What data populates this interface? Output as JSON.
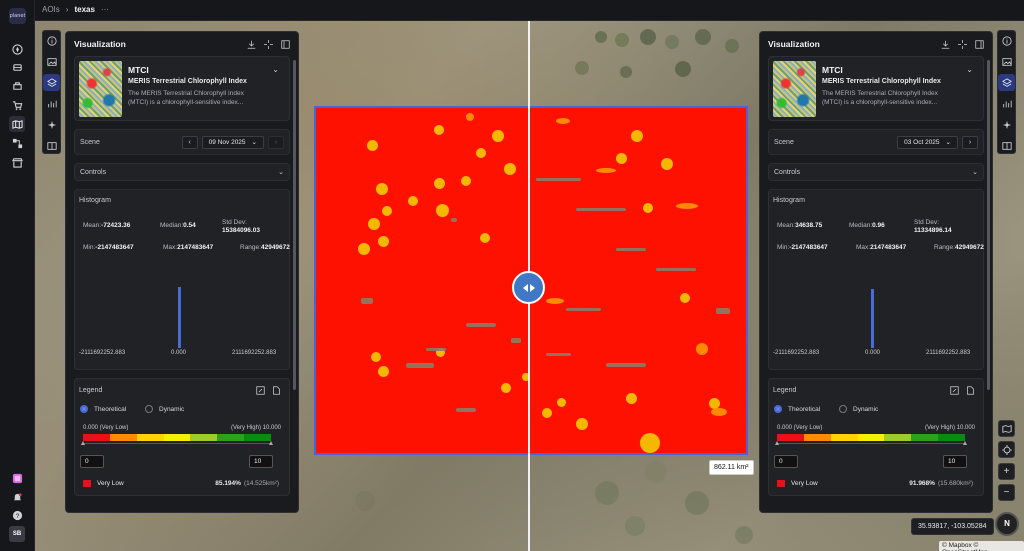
{
  "breadcrumb": {
    "root": "AOIs",
    "current": "texas",
    "more": "···"
  },
  "app": {
    "logo_text": "planet",
    "user_initials": "SB"
  },
  "colors": {
    "accent": "#4b6ad6",
    "overlay_red": "#ff1100",
    "overlay_yellow": "#f5b800",
    "panel_bg": "#1a1b1f"
  },
  "panels": [
    {
      "title": "Visualization",
      "index": {
        "code": "MTCI",
        "name": "MERIS Terrestrial Chlorophyll Index",
        "desc": "The MERIS Terrestrial Chlorophyll Index (MTCI) is a chlorophyll-sensitive index..."
      },
      "scene": {
        "label": "Scene",
        "date": "09 Nov 2025"
      },
      "controls": "Controls",
      "histogram": {
        "title": "Histogram",
        "mean_label": "Mean:",
        "mean": "-72423.36",
        "median_label": "Median:",
        "median": "0.54",
        "std_label": "Std Dev:",
        "std": "15384096.03",
        "min_label": "Min:",
        "min": "-2147483647",
        "max_label": "Max:",
        "max": "2147483647",
        "range_label": "Range:",
        "range": "42949672",
        "x_min": "-2111692252.883",
        "x_mid": "0.000",
        "x_max": "2111692252.883",
        "peak_fraction": 0.95
      },
      "legend": {
        "title": "Legend",
        "opt_theoretical": "Theoretical",
        "opt_dynamic": "Dynamic",
        "low_label": "0.000 (Very Low)",
        "high_label": "(Very High) 10.000",
        "min_input": "0",
        "max_input": "10",
        "class_name": "Very Low",
        "class_pct": "85.194%",
        "class_area": "(14.525km²)"
      }
    },
    {
      "title": "Visualization",
      "index": {
        "code": "MTCI",
        "name": "MERIS Terrestrial Chlorophyll Index",
        "desc": "The MERIS Terrestrial Chlorophyll Index (MTCI) is a chlorophyll-sensitive index..."
      },
      "scene": {
        "label": "Scene",
        "date": "03 Oct 2025"
      },
      "controls": "Controls",
      "histogram": {
        "title": "Histogram",
        "mean_label": "Mean:",
        "mean": "34638.75",
        "median_label": "Median:",
        "median": "0.96",
        "std_label": "Std Dev:",
        "std": "11334896.14",
        "min_label": "Min:",
        "min": "-2147483647",
        "max_label": "Max:",
        "max": "2147483647",
        "range_label": "Range:",
        "range": "42949672",
        "x_min": "-2111692252.883",
        "x_mid": "0.000",
        "x_max": "2111692252.883",
        "peak_fraction": 0.92
      },
      "legend": {
        "title": "Legend",
        "opt_theoretical": "Theoretical",
        "opt_dynamic": "Dynamic",
        "low_label": "0.000 (Very Low)",
        "high_label": "(Very High) 10.000",
        "min_input": "0",
        "max_input": "10",
        "class_name": "Very Low",
        "class_pct": "91.968%",
        "class_area": "(15.680km²)"
      }
    }
  ],
  "ramp_colors": [
    "#e8101a",
    "#ff8c00",
    "#ffd400",
    "#f6f000",
    "#9ccc2a",
    "#2f9f1f",
    "#0c8a16"
  ],
  "map": {
    "area_label": "862.11 km²",
    "coords": "35.93817, -103.05284",
    "attribution": "© Mapbox © OpenStreetMap",
    "compass": "N",
    "zoom_in": "+",
    "zoom_out": "−"
  }
}
